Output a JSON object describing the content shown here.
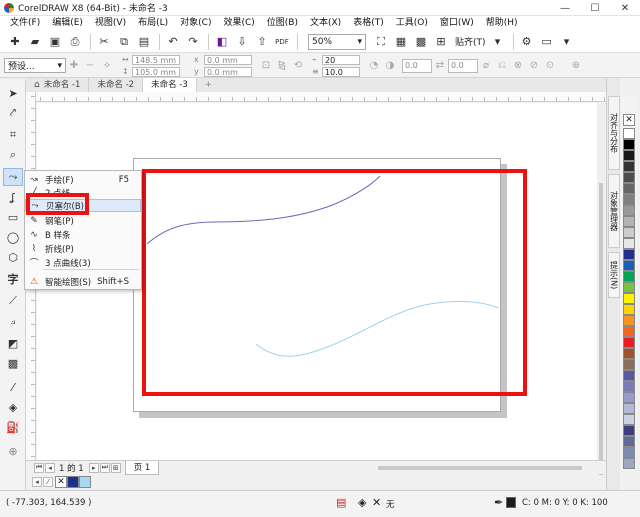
{
  "window": {
    "title": "CorelDRAW X8 (64-Bit) - 未命名 -3",
    "minimize": "—",
    "maximize": "☐",
    "close": "✕"
  },
  "menu": [
    "文件(F)",
    "编辑(E)",
    "视图(V)",
    "布局(L)",
    "对象(C)",
    "效果(C)",
    "位图(B)",
    "文本(X)",
    "表格(T)",
    "工具(O)",
    "窗口(W)",
    "帮助(H)"
  ],
  "toolbar": {
    "zoom": "50%",
    "paste_label": "贴齐(T)",
    "pdf_label": "PDF"
  },
  "propbar": {
    "preset": "预设...",
    "width": "148.5 mm",
    "height": "105.0 mm",
    "x": "0.0 mm",
    "y": "0.0 mm",
    "nodes": "20",
    "outline": "10.0 mm",
    "angle": "0.0",
    "angle2": "0.0"
  },
  "tabs": [
    {
      "label": "未命名 -1"
    },
    {
      "label": "未命名 -2"
    },
    {
      "label": "未命名 -3"
    }
  ],
  "flyout": [
    {
      "icon": "freehand-icon",
      "glyph": "↝",
      "label": "手绘(F)",
      "shortcut": "F5"
    },
    {
      "icon": "two-point-line-icon",
      "glyph": "╱",
      "label": "2 点线",
      "shortcut": ""
    },
    {
      "icon": "bezier-icon",
      "glyph": "⤳",
      "label": "贝塞尔(B)",
      "shortcut": ""
    },
    {
      "icon": "pen-icon",
      "glyph": "✎",
      "label": "钢笔(P)",
      "shortcut": ""
    },
    {
      "icon": "b-spline-icon",
      "glyph": "∿",
      "label": "B 样条",
      "shortcut": ""
    },
    {
      "icon": "polyline-icon",
      "glyph": "⌇",
      "label": "折线(P)",
      "shortcut": ""
    },
    {
      "icon": "three-point-curve-icon",
      "glyph": "⌒",
      "label": "3 点曲线(3)",
      "shortcut": ""
    },
    {
      "icon": "smart-drawing-icon",
      "glyph": "⚠",
      "label": "智能绘图(S)",
      "shortcut": "Shift+S"
    }
  ],
  "docker_tabs": [
    "对齐与分布",
    "对象管理器",
    "提示(N)"
  ],
  "palette": [
    "#ffffff",
    "#000000",
    "#1a1a1a",
    "#333333",
    "#4d4d4d",
    "#666666",
    "#808080",
    "#999999",
    "#b3b3b3",
    "#cccccc",
    "#e6e6e6",
    "#1e2f8f",
    "#1560bd",
    "#00a651",
    "#79c142",
    "#fff200",
    "#ffd400",
    "#f7941d",
    "#f26522",
    "#ed1c24",
    "#a0522d",
    "#8b6d5c",
    "#5a5aa0",
    "#7a7ab8",
    "#9999cc",
    "#b6b6d8",
    "#cfcfe6",
    "#3d3d80",
    "#5d6a9a",
    "#7d8bb0",
    "#9da7c4"
  ],
  "pagenav": {
    "page_of": "1 的 1",
    "page_tab": "页 1"
  },
  "status": {
    "coords": "( -77.303, 164.539 )",
    "fill_none": "无",
    "outline_color": "#1a1a1a",
    "cmyk": "C: 0 M: 0 Y: 0 K: 100"
  },
  "canvas": {
    "curve1_color": "#6b6bb8",
    "curve2_color": "#9fd0ee",
    "highlight_color": "#ee1111"
  }
}
